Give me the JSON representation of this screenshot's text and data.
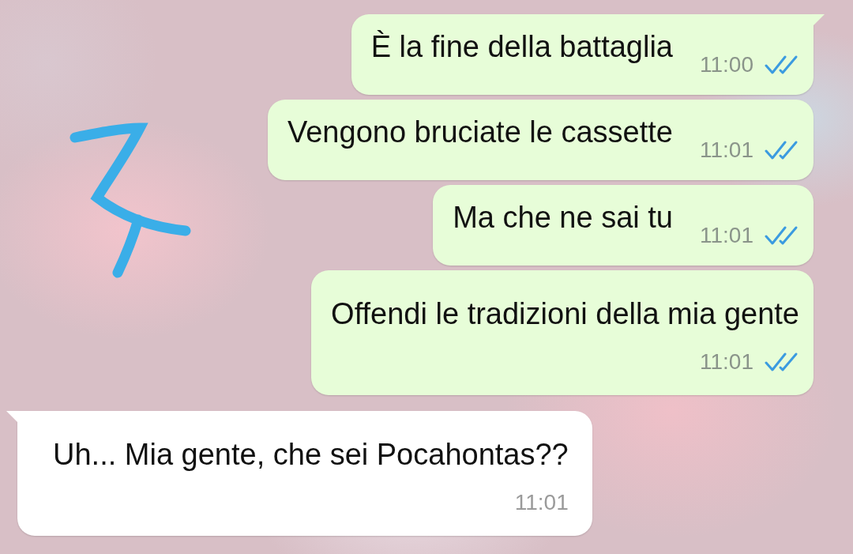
{
  "messages": [
    {
      "kind": "outgoing",
      "text": "È la fine della battaglia",
      "time": "11:00",
      "read": true
    },
    {
      "kind": "outgoing",
      "text": "Vengono bruciate le cassette",
      "time": "11:01",
      "read": true
    },
    {
      "kind": "outgoing",
      "text": "Ma che ne sai tu",
      "time": "11:01",
      "read": true
    },
    {
      "kind": "outgoing",
      "text": "Offendi le tradizioni della mia gente",
      "time": "11:01",
      "read": true
    },
    {
      "kind": "incoming",
      "text": "Uh... Mia gente, che sei Pocahontas??",
      "time": "11:01"
    }
  ]
}
